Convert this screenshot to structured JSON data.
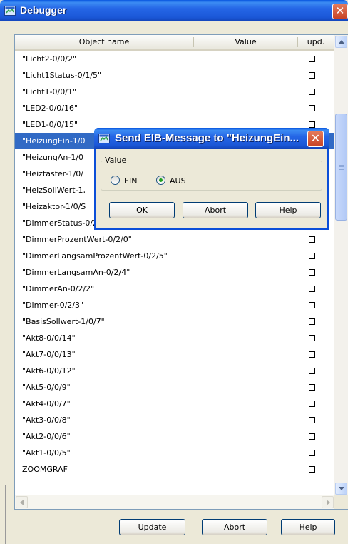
{
  "window": {
    "title": "Debugger",
    "close_glyph": "✕"
  },
  "columns": {
    "name": "Object name",
    "value": "Value",
    "upd": "upd."
  },
  "rows": [
    {
      "name": "\"Licht2-0/0/2\""
    },
    {
      "name": "\"Licht1Status-0/1/5\""
    },
    {
      "name": "\"Licht1-0/0/1\""
    },
    {
      "name": "\"LED2-0/0/16\""
    },
    {
      "name": "\"LED1-0/0/15\""
    },
    {
      "name": "\"HeizungEin-1/0",
      "selected": true
    },
    {
      "name": "\"HeizungAn-1/0"
    },
    {
      "name": "\"Heiztaster-1/0/"
    },
    {
      "name": "\"HeizSollWert-1,"
    },
    {
      "name": "\"Heizaktor-1/0/S"
    },
    {
      "name": "\"DimmerStatus-0/2/1\""
    },
    {
      "name": "\"DimmerProzentWert-0/2/0\""
    },
    {
      "name": "\"DimmerLangsamProzentWert-0/2/5\""
    },
    {
      "name": "\"DimmerLangsamAn-0/2/4\""
    },
    {
      "name": "\"DimmerAn-0/2/2\""
    },
    {
      "name": "\"Dimmer-0/2/3\""
    },
    {
      "name": "\"BasisSollwert-1/0/7\""
    },
    {
      "name": "\"Akt8-0/0/14\""
    },
    {
      "name": "\"Akt7-0/0/13\""
    },
    {
      "name": "\"Akt6-0/0/12\""
    },
    {
      "name": "\"Akt5-0/0/9\""
    },
    {
      "name": "\"Akt4-0/0/7\""
    },
    {
      "name": "\"Akt3-0/0/8\""
    },
    {
      "name": "\"Akt2-0/0/6\""
    },
    {
      "name": "\"Akt1-0/0/5\""
    },
    {
      "name": "ZOOMGRAF"
    }
  ],
  "footer": {
    "update_label": "Update",
    "abort_label": "Abort",
    "help_label": "Help"
  },
  "dialog": {
    "title": "Send EIB-Message to \"HeizungEin...",
    "close_glyph": "✕",
    "group_label": "Value",
    "options": [
      {
        "label": "EIN",
        "selected": false
      },
      {
        "label": "AUS",
        "selected": true
      }
    ],
    "ok_label": "OK",
    "abort_label": "Abort",
    "help_label": "Help"
  },
  "colors": {
    "titlebar": "#2566E6",
    "selection": "#316AC5",
    "radio_dot": "#21A121"
  }
}
